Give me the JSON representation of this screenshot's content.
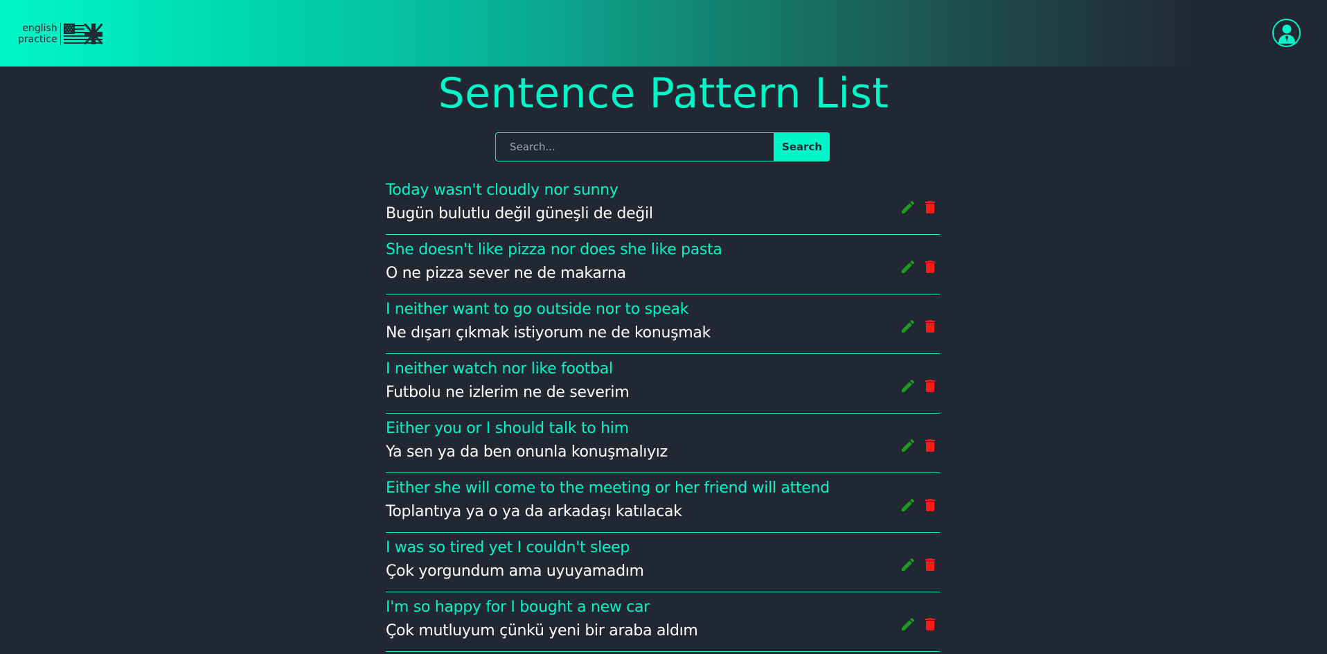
{
  "logo": {
    "line1": "english",
    "line2": "practice"
  },
  "page_title": "Sentence Pattern List",
  "search": {
    "placeholder": "Search...",
    "button_label": "Search"
  },
  "colors": {
    "accent": "#00f5c8",
    "background": "#212833",
    "edit": "#1e9a1e",
    "delete": "#ff1a1a"
  },
  "patterns": [
    {
      "english": "Today wasn't cloudly nor sunny",
      "turkish": "Bugün bulutlu değil güneşli de değil"
    },
    {
      "english": "She doesn't like pizza nor does she like pasta",
      "turkish": "O ne pizza sever ne de makarna"
    },
    {
      "english": "I neither want to go outside nor to speak",
      "turkish": "Ne dışarı çıkmak istiyorum ne de konuşmak"
    },
    {
      "english": "I neither watch nor like footbal",
      "turkish": "Futbolu ne izlerim ne de severim"
    },
    {
      "english": "Either you or I should talk to him",
      "turkish": "Ya sen ya da ben onunla konuşmalıyız"
    },
    {
      "english": "Either she will come to the meeting or her friend will attend",
      "turkish": "Toplantıya ya o ya da arkadaşı katılacak"
    },
    {
      "english": "I was so tired yet I couldn't sleep",
      "turkish": "Çok yorgundum ama uyuyamadım"
    },
    {
      "english": "I'm so happy for I bought a new car",
      "turkish": "Çok mutluyum çünkü yeni bir araba aldım"
    }
  ],
  "icons": {
    "edit": "pencil-icon",
    "delete": "trash-icon",
    "profile": "user-profile-icon",
    "flag": "us-uk-flag-icon"
  }
}
